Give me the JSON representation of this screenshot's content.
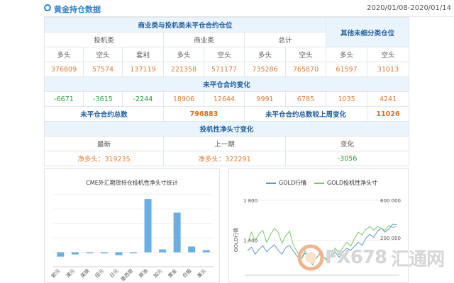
{
  "header": {
    "title": "黄金持仓数据",
    "date_range": "2020/01/08-2020/01/14"
  },
  "table": {
    "group_title": "商业类与投机类未平仓合约仓位",
    "other_title": "其他未细分类仓位",
    "spec": "投机类",
    "comm": "商业类",
    "total": "总计",
    "sub": [
      "多头",
      "空头",
      "套利",
      "多头",
      "空头",
      "多头",
      "空头",
      "多头",
      "空头"
    ],
    "values": [
      "376809",
      "57574",
      "137119",
      "221358",
      "571177",
      "735286",
      "765870",
      "61597",
      "31013"
    ],
    "change_title": "未平仓合约变化",
    "changes": [
      "-6671",
      "-3615",
      "-2244",
      "18906",
      "12644",
      "9991",
      "6785",
      "1035",
      "4241"
    ],
    "oi_total_label": "未平仓合约总数",
    "oi_total": "796883",
    "oi_change_label": "未平仓合约总数较上周变化",
    "oi_change": "11026",
    "net_title": "投机性净头寸变化",
    "latest_label": "最新",
    "prev_label": "上一期",
    "delta_label": "变化",
    "latest": "净多头：319235",
    "prev": "净多头：322291",
    "delta": "-3056"
  },
  "chart1": {
    "title": "CME外汇期货持仓投机性净头寸统计",
    "chart_data": {
      "type": "bar",
      "categories": [
        "欧元",
        "澳元",
        "英镑",
        "纽元",
        "日元",
        "墨西哥",
        "原油",
        "加元",
        "黄金",
        "白银",
        "美元"
      ],
      "values": [
        -6,
        -3,
        -1,
        0,
        -4,
        0,
        74,
        4,
        55,
        8,
        3
      ],
      "color": "#6aaee6"
    }
  },
  "chart2": {
    "legend": [
      "GOLD行情",
      "GOLD投机性净头寸"
    ],
    "left_axis_label": "GOLD行情",
    "chart_data": {
      "type": "line",
      "ylim_left": [
        1050,
        1800
      ],
      "ylim_right": [
        -200000,
        600000
      ],
      "left_ticks": [
        "1 800",
        "1 400"
      ],
      "right_ticks": [
        "600 000",
        "200 000"
      ],
      "series": [
        {
          "name": "GOLD行情",
          "color": "#5b9bd5",
          "values": [
            1295,
            1330,
            1260,
            1310,
            1345,
            1285,
            1320,
            1355,
            1300,
            1260,
            1325,
            1350,
            1290,
            1240,
            1210,
            1270,
            1235,
            1190,
            1220,
            1265,
            1230,
            1200,
            1245,
            1280,
            1230,
            1285,
            1320,
            1300,
            1340,
            1380,
            1350,
            1420,
            1460,
            1430,
            1490,
            1520,
            1480,
            1510,
            1560,
            1555
          ]
        },
        {
          "name": "GOLD投机性净头寸",
          "color": "#7cc96b",
          "values": [
            140000,
            260000,
            170000,
            240000,
            280000,
            150000,
            230000,
            300000,
            260000,
            140000,
            220000,
            270000,
            120000,
            50000,
            -30000,
            60000,
            0,
            -90000,
            -20000,
            40000,
            -10000,
            -60000,
            30000,
            90000,
            20000,
            100000,
            150000,
            110000,
            190000,
            260000,
            230000,
            290000,
            320000,
            280000,
            320000,
            300000,
            280000,
            330000,
            310000,
            320000
          ]
        }
      ]
    }
  },
  "watermark": {
    "text": "FX678",
    "cn": "汇通网"
  }
}
